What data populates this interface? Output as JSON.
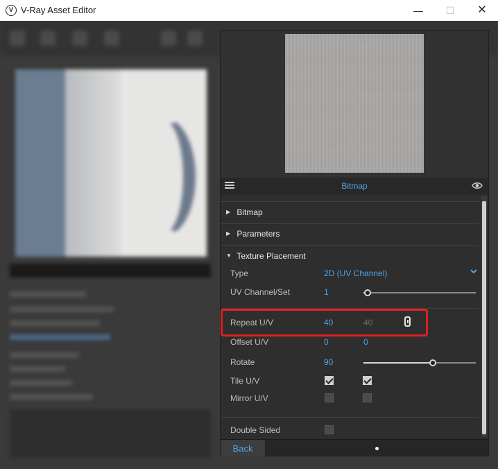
{
  "window": {
    "title": "V-Ray Asset Editor",
    "logo_glyph": "V",
    "minimize_glyph": "—",
    "maximize_glyph": "☐",
    "close_glyph": "✕"
  },
  "asset": {
    "header_title": "Bitmap",
    "preview_color": "#aaa9a7"
  },
  "sections": [
    {
      "label": "Bitmap",
      "expanded": false,
      "arrow": "▶"
    },
    {
      "label": "Parameters",
      "expanded": false,
      "arrow": "▶"
    },
    {
      "label": "Texture Placement",
      "expanded": true,
      "arrow": "▼"
    }
  ],
  "texture_placement": {
    "type": {
      "label": "Type",
      "value": "2D (UV Channel)"
    },
    "uv_channel": {
      "label": "UV Channel/Set",
      "value": "1",
      "slider_fraction": 0.04
    },
    "repeat_uv": {
      "label": "Repeat U/V",
      "u": "40",
      "v": "40",
      "linked": true
    },
    "offset_uv": {
      "label": "Offset U/V",
      "u": "0",
      "v": "0"
    },
    "rotate": {
      "label": "Rotate",
      "value": "90",
      "slider_fraction": 0.62
    },
    "tile_uv": {
      "label": "Tile U/V",
      "u_checked": true,
      "v_checked": true
    },
    "mirror_uv": {
      "label": "Mirror U/V",
      "u_checked": false,
      "v_checked": false
    },
    "double_sided": {
      "label": "Double Sided",
      "checked": false
    }
  },
  "footer": {
    "back_label": "Back"
  },
  "colors": {
    "accent": "#4da3e8",
    "highlight": "#e02020",
    "panel_bg": "#2e2e2e"
  },
  "icons": {
    "header_left": "hamburger-list-icon",
    "header_right": "eye-icon",
    "repeat_link": "chain-link-icon",
    "type_dropdown": "chevron-down-icon"
  }
}
